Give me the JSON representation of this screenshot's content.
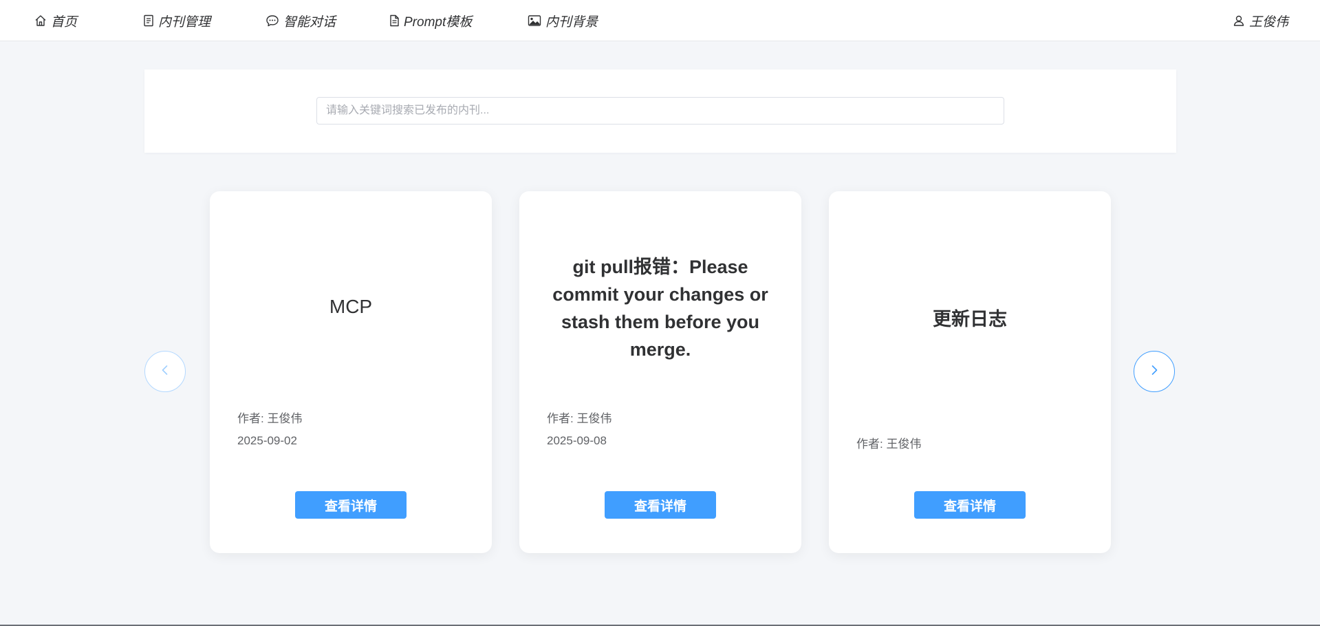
{
  "nav": {
    "home": "首页",
    "journal_mgmt": "内刊管理",
    "chat": "智能对话",
    "prompt": "Prompt模板",
    "background": "内刊背景",
    "user": "王俊伟"
  },
  "search": {
    "placeholder": "请输入关键词搜索已发布的内刊..."
  },
  "cards": [
    {
      "title": "MCP",
      "author": "作者: 王俊伟",
      "date": "2025-09-02",
      "button": "查看详情"
    },
    {
      "title": "git pull报错：Please commit your changes or stash them before you merge.",
      "author": "作者: 王俊伟",
      "date": "2025-09-08",
      "button": "查看详情"
    },
    {
      "title": "更新日志",
      "author": "作者: 王俊伟",
      "button": "查看详情"
    }
  ],
  "colors": {
    "accent": "#409eff",
    "page_bg": "#f4f6f9"
  },
  "icons": {
    "home": "home-icon",
    "journal": "document-icon",
    "chat": "chat-bubble-icon",
    "prompt": "file-icon",
    "background": "image-icon",
    "user": "user-icon",
    "prev": "chevron-left-icon",
    "next": "chevron-right-icon"
  }
}
